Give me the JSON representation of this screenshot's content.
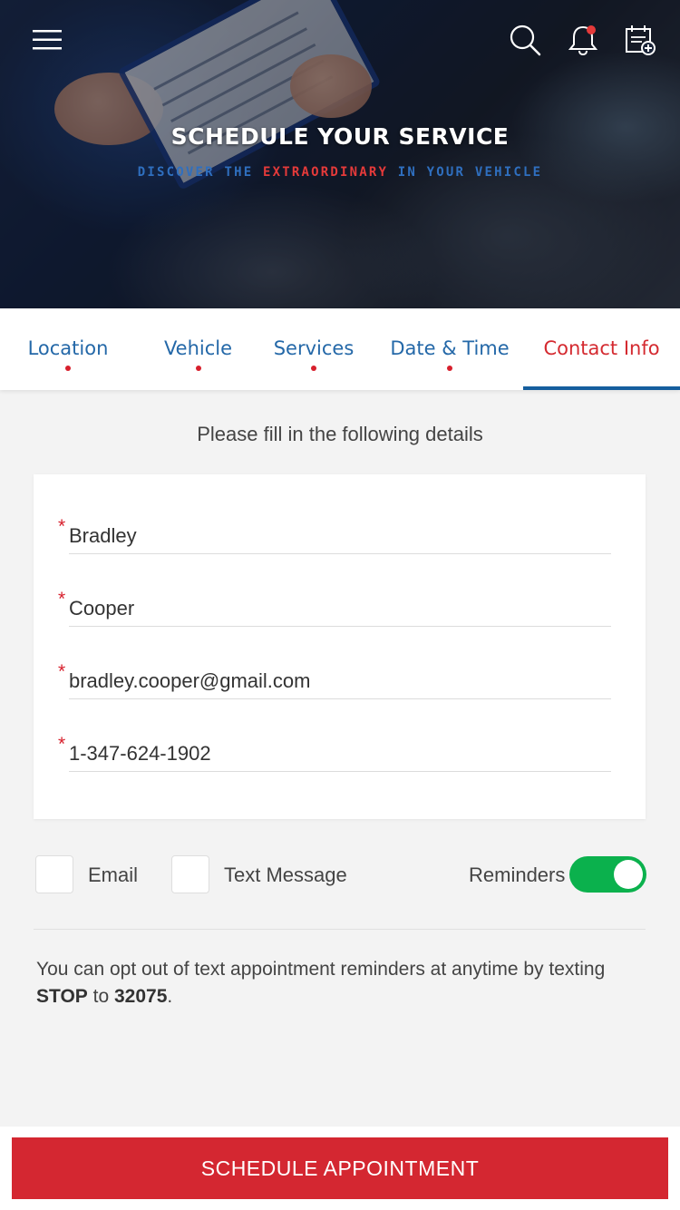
{
  "header": {
    "title": "SCHEDULE YOUR SERVICE",
    "subtitle_pre": "DISCOVER THE ",
    "subtitle_accent": "EXTRAORDINARY",
    "subtitle_post": " IN YOUR VEHICLE",
    "icons": [
      "menu-icon",
      "search-icon",
      "bell-icon",
      "calendar-add-icon"
    ],
    "notification_dot_color": "#e53a3a"
  },
  "tabs": [
    {
      "label": "Location",
      "completed": true
    },
    {
      "label": "Vehicle",
      "completed": true
    },
    {
      "label": "Services",
      "completed": true
    },
    {
      "label": "Date & Time",
      "completed": true
    },
    {
      "label": "Contact Info",
      "active": true
    }
  ],
  "form": {
    "instructions": "Please fill in the following details",
    "required_marker": "*",
    "fields": [
      {
        "value": "Bradley"
      },
      {
        "value": "Cooper"
      },
      {
        "value": "bradley.cooper@gmail.com"
      },
      {
        "value": "1-347-624-1902"
      }
    ]
  },
  "preferences": {
    "email_label": "Email",
    "email_checked": false,
    "text_label": "Text Message",
    "text_checked": false,
    "reminders_label": "Reminders",
    "reminders_on": true
  },
  "optout": {
    "text_pre": "You can opt out of text appointment reminders at anytime by texting ",
    "keyword": "STOP",
    "text_mid": " to ",
    "number": "32075",
    "text_post": "."
  },
  "footer": {
    "cta_label": "SCHEDULE APPOINTMENT"
  },
  "colors": {
    "brand_red": "#d42731",
    "brand_blue": "#2468a8",
    "toggle_green": "#0bb14d"
  }
}
